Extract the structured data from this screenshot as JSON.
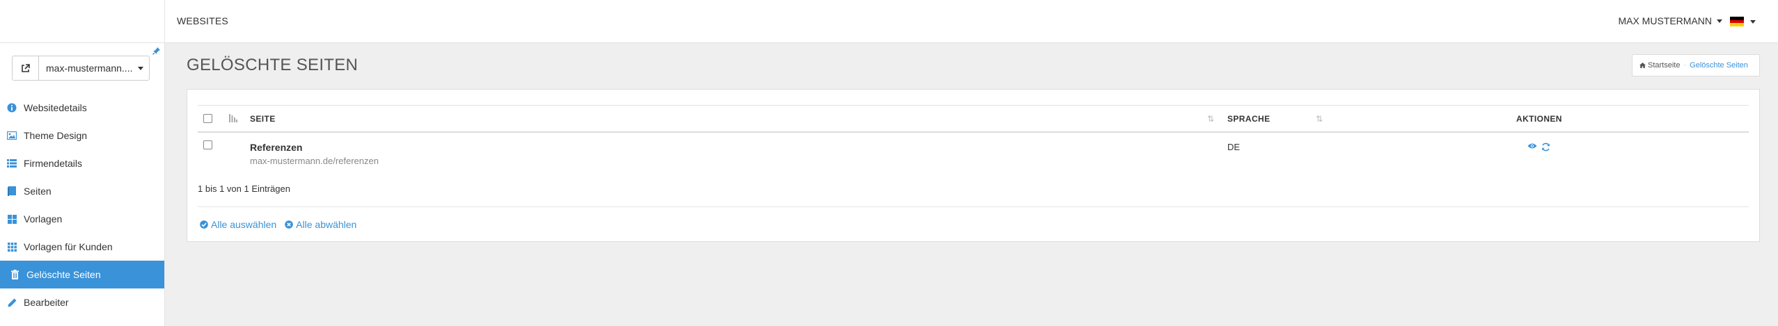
{
  "topbar": {
    "nav_websites": "WEBSITES",
    "user_name": "MAX MUSTERMANN"
  },
  "sidebar": {
    "site_select_value": "max-mustermann....",
    "items": [
      {
        "label": "Websitedetails",
        "icon": "info-circle-icon"
      },
      {
        "label": "Theme Design",
        "icon": "image-icon"
      },
      {
        "label": "Firmendetails",
        "icon": "list-icon"
      },
      {
        "label": "Seiten",
        "icon": "book-icon"
      },
      {
        "label": "Vorlagen",
        "icon": "grid-large-icon"
      },
      {
        "label": "Vorlagen für Kunden",
        "icon": "grid-small-icon"
      },
      {
        "label": "Gelöschte Seiten",
        "icon": "trash-icon"
      },
      {
        "label": "Bearbeiter",
        "icon": "pencil-icon"
      }
    ]
  },
  "page": {
    "title": "GELÖSCHTE SEITEN",
    "breadcrumb": {
      "home": "Startseite",
      "current": "Gelöschte Seiten"
    }
  },
  "table": {
    "columns": {
      "seite": "SEITE",
      "sprache": "SPRACHE",
      "aktionen": "AKTIONEN"
    },
    "rows": [
      {
        "title": "Referenzen",
        "url": "max-mustermann.de/referenzen",
        "lang": "DE"
      }
    ],
    "info": "1 bis 1 von 1 Einträgen"
  },
  "selection": {
    "select_all": "Alle auswählen",
    "deselect_all": "Alle abwählen"
  },
  "colors": {
    "accent": "#3a92d8",
    "active_bg": "#3a92d8"
  }
}
